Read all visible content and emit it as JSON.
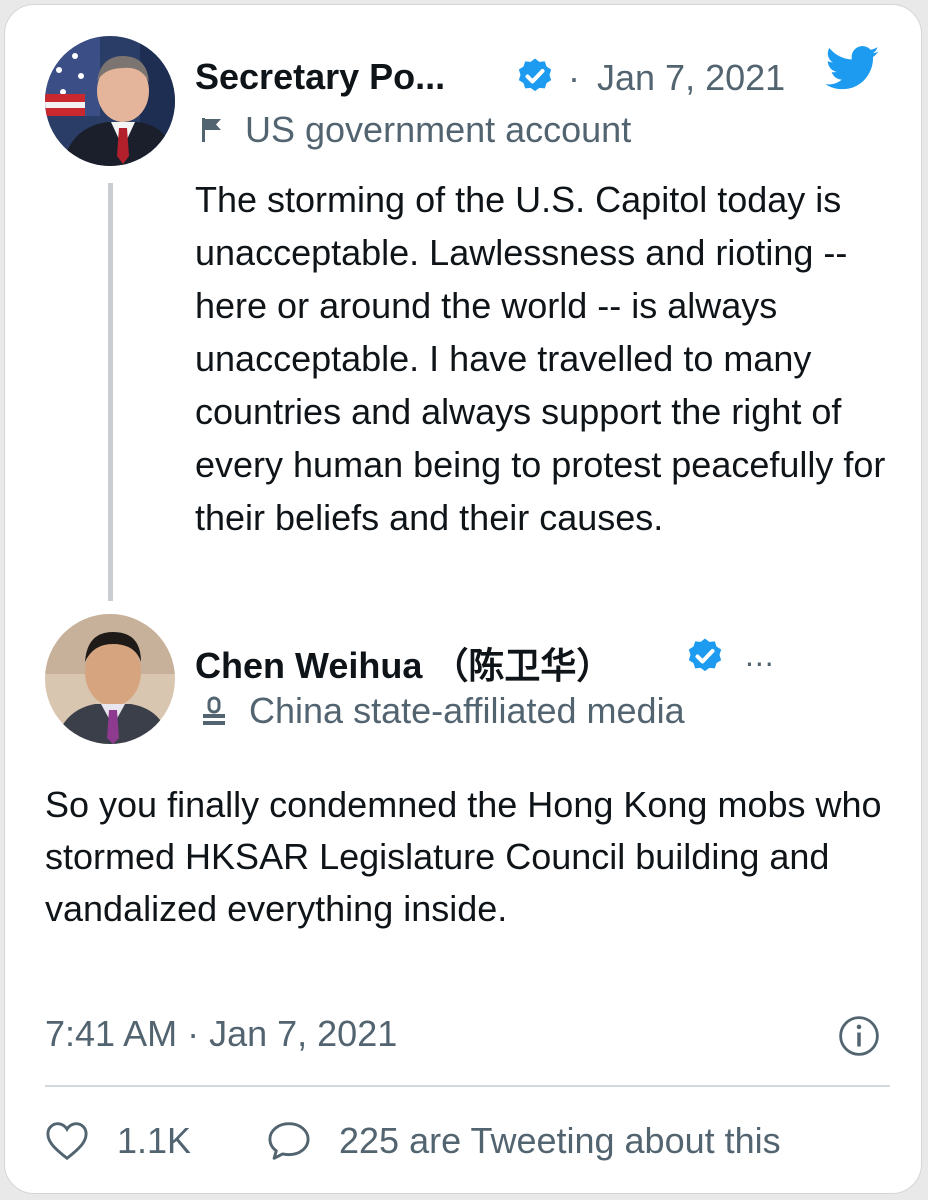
{
  "tweet": {
    "author_name": "Secretary Po...",
    "separator": "·",
    "date": "Jan 7, 2021",
    "account_label": "US government account",
    "text": "The storming of the U.S. Capitol today is unacceptable. Lawlessness and rioting -- here or around the world -- is always unacceptable. I have travelled to many countries and always support the right of every human being to protest peacefully for their beliefs and their causes."
  },
  "reply": {
    "author_name": "Chen Weihua （陈卫华）",
    "more": "...",
    "account_label": "China state-affiliated media",
    "text": "So you finally condemned the Hong Kong mobs who stormed HKSAR Legislature Council building and vandalized everything inside.",
    "timestamp": "7:41 AM · Jan 7, 2021",
    "likes": "1.1K",
    "tweeting_about": "225 are Tweeting about this"
  },
  "colors": {
    "twitter_blue": "#1d9bf0",
    "muted_text": "#536471",
    "main_text": "#0f1419"
  },
  "icons": [
    "twitter-bird-icon",
    "verified-badge-icon",
    "flag-icon",
    "microphone-icon",
    "info-icon",
    "heart-icon",
    "speech-bubble-icon"
  ]
}
